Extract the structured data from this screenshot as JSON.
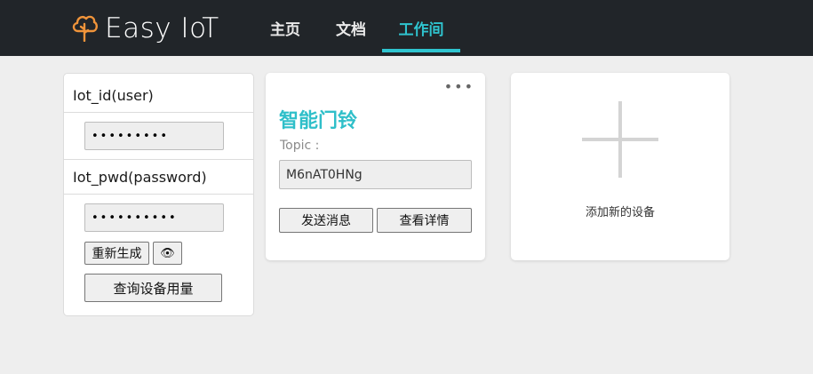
{
  "header": {
    "brand": "Easy IoT",
    "nav": [
      {
        "label": "主页"
      },
      {
        "label": "文档"
      },
      {
        "label": "工作间"
      }
    ]
  },
  "credentials": {
    "id_label": "Iot_id(user)",
    "id_value": "•••••••••",
    "pwd_label": "Iot_pwd(password)",
    "pwd_value": "••••••••••",
    "regenerate_label": "重新生成",
    "show_label": "👁",
    "query_label": "查询设备用量"
  },
  "device": {
    "menu": "•••",
    "title": "智能门铃",
    "topic_label": "Topic :",
    "topic_value": "M6nAT0HNg",
    "send_label": "发送消息",
    "details_label": "查看详情"
  },
  "add_device": {
    "label": "添加新的设备"
  },
  "colors": {
    "accent": "#2fc4cf",
    "header_bg": "#212529",
    "logo": "#f0943a"
  }
}
